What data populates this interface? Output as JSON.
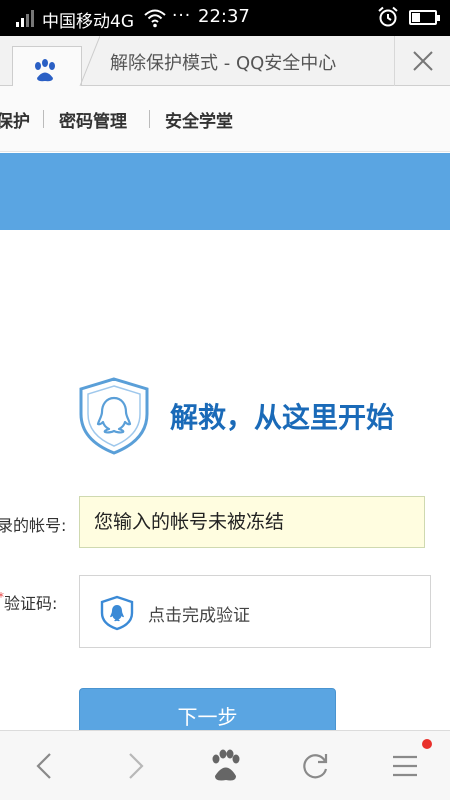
{
  "status_bar": {
    "carrier": "中国移动4G",
    "dots": "···",
    "time": "22:37",
    "battery_level": 0.35
  },
  "browser": {
    "tab_title": "解除保护模式 - QQ安全中心"
  },
  "page_nav": {
    "items": [
      "保护",
      "密码管理",
      "安全学堂"
    ]
  },
  "hero": {
    "title": "解救，从这里开始"
  },
  "form": {
    "account_label": "录的帐号:",
    "account_value": "您输入的帐号未被冻结",
    "captcha_label": "验证码:",
    "captcha_required_mark": "*",
    "captcha_prompt": "点击完成验证",
    "next_button": "下一步"
  },
  "colors": {
    "accent": "#5aa5e2",
    "brand_text": "#1a6ab8",
    "notify": "#e9302b"
  },
  "icons": {
    "favicon": "baidu-paw-icon",
    "toolbar": [
      "back-icon",
      "forward-icon",
      "baidu-paw-icon",
      "refresh-icon",
      "menu-icon"
    ]
  }
}
